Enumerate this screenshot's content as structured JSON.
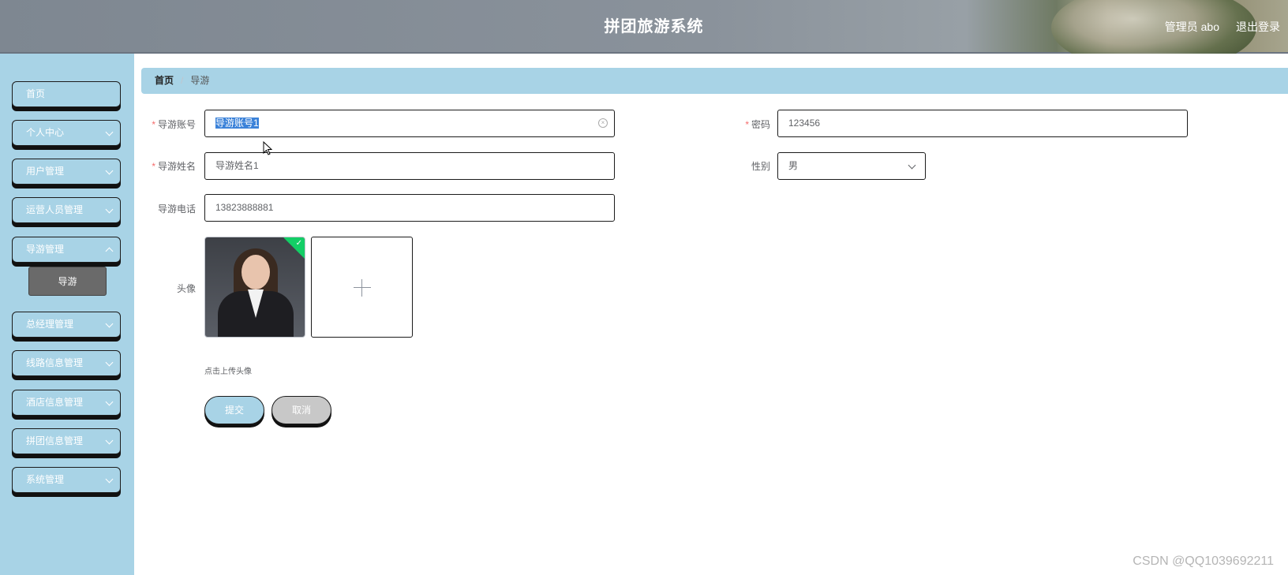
{
  "header": {
    "title": "拼团旅游系统",
    "user": "管理员 abo",
    "logout": "退出登录"
  },
  "sidebar": {
    "items": [
      {
        "label": "首页",
        "has_children": false
      },
      {
        "label": "个人中心",
        "has_children": true
      },
      {
        "label": "用户管理",
        "has_children": true
      },
      {
        "label": "运营人员管理",
        "has_children": true
      },
      {
        "label": "导游管理",
        "has_children": true
      },
      {
        "label": "总经理管理",
        "has_children": true
      },
      {
        "label": "线路信息管理",
        "has_children": true
      },
      {
        "label": "酒店信息管理",
        "has_children": true
      },
      {
        "label": "拼团信息管理",
        "has_children": true
      },
      {
        "label": "系统管理",
        "has_children": true
      }
    ],
    "active_sub": "导游"
  },
  "breadcrumb": {
    "home": "首页",
    "current": "导游"
  },
  "form": {
    "account": {
      "label": "导游账号",
      "required": true,
      "value": "导游账号1"
    },
    "password": {
      "label": "密码",
      "required": true,
      "value": "123456"
    },
    "name": {
      "label": "导游姓名",
      "required": true,
      "value": "导游姓名1"
    },
    "gender": {
      "label": "性别",
      "value": "男"
    },
    "phone": {
      "label": "导游电话",
      "value": "13823888881"
    },
    "avatar": {
      "label": "头像",
      "tip": "点击上传头像"
    },
    "submit": "提交",
    "cancel": "取消"
  },
  "watermark": "CSDN @QQ1039692211"
}
